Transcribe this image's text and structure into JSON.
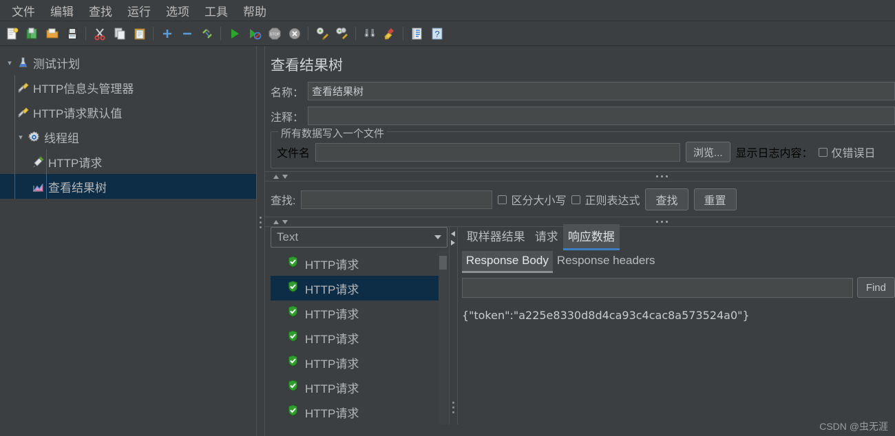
{
  "menubar": {
    "items": [
      {
        "label": "文件",
        "name": "menu-file"
      },
      {
        "label": "编辑",
        "name": "menu-edit"
      },
      {
        "label": "查找",
        "name": "menu-search"
      },
      {
        "label": "运行",
        "name": "menu-run"
      },
      {
        "label": "选项",
        "name": "menu-options"
      },
      {
        "label": "工具",
        "name": "menu-tools"
      },
      {
        "label": "帮助",
        "name": "menu-help"
      }
    ]
  },
  "toolbar": {
    "buttons": [
      {
        "icon": "new-document-icon"
      },
      {
        "icon": "open-template-icon"
      },
      {
        "icon": "open-folder-icon"
      },
      {
        "icon": "save-icon"
      },
      {
        "sep": true
      },
      {
        "icon": "cut-scissors-icon"
      },
      {
        "icon": "copy-icon"
      },
      {
        "icon": "paste-clipboard-icon"
      },
      {
        "sep": true
      },
      {
        "icon": "add-plus-icon"
      },
      {
        "icon": "remove-minus-icon"
      },
      {
        "icon": "toggle-icon"
      },
      {
        "sep": true
      },
      {
        "icon": "start-play-icon"
      },
      {
        "icon": "start-no-pauses-icon"
      },
      {
        "icon": "stop-icon"
      },
      {
        "icon": "shutdown-icon"
      },
      {
        "sep": true
      },
      {
        "icon": "clear-icon"
      },
      {
        "icon": "clear-all-icon"
      },
      {
        "sep": true
      },
      {
        "icon": "search-binoculars-icon"
      },
      {
        "icon": "search-reset-broom-icon"
      },
      {
        "sep": true
      },
      {
        "icon": "function-helper-icon"
      },
      {
        "icon": "help-question-icon"
      }
    ]
  },
  "tree": {
    "nodes": [
      {
        "label": "测试计划",
        "icon": "test-plan-icon",
        "level": 0,
        "expanded": true,
        "selected": false
      },
      {
        "label": "HTTP信息头管理器",
        "icon": "header-manager-icon",
        "level": 1,
        "expanded": null,
        "selected": false
      },
      {
        "label": "HTTP请求默认值",
        "icon": "http-defaults-icon",
        "level": 1,
        "expanded": null,
        "selected": false
      },
      {
        "label": "线程组",
        "icon": "thread-group-icon",
        "level": 1,
        "expanded": true,
        "selected": false
      },
      {
        "label": "HTTP请求",
        "icon": "http-request-icon",
        "level": 2,
        "expanded": null,
        "selected": false
      },
      {
        "label": "查看结果树",
        "icon": "view-results-tree-icon",
        "level": 2,
        "expanded": null,
        "selected": true
      }
    ]
  },
  "panel": {
    "title": "查看结果树",
    "name_label": "名称：",
    "name_value": "查看结果树",
    "comment_label": "注释：",
    "comment_value": "",
    "filegroup": {
      "title": "所有数据写入一个文件",
      "filename_label": "文件名",
      "filename_value": "",
      "browse_button": "浏览...",
      "log_display_label": "显示日志内容：",
      "errors_only_label": "仅错误日",
      "errors_only_checked": false
    },
    "search": {
      "label": "查找:",
      "value": "",
      "case_sensitive_label": "区分大小写",
      "case_sensitive_checked": false,
      "regex_label": "正则表达式",
      "regex_checked": false,
      "find_button": "查找",
      "reset_button": "重置"
    },
    "renderer": {
      "selected": "Text"
    },
    "results": [
      {
        "label": "HTTP请求",
        "status": "success",
        "selected": false
      },
      {
        "label": "HTTP请求",
        "status": "success",
        "selected": true
      },
      {
        "label": "HTTP请求",
        "status": "success",
        "selected": false
      },
      {
        "label": "HTTP请求",
        "status": "success",
        "selected": false
      },
      {
        "label": "HTTP请求",
        "status": "success",
        "selected": false
      },
      {
        "label": "HTTP请求",
        "status": "success",
        "selected": false
      },
      {
        "label": "HTTP请求",
        "status": "success",
        "selected": false
      }
    ],
    "tabs": [
      {
        "label": "取样器结果",
        "active": false
      },
      {
        "label": "请求",
        "active": false
      },
      {
        "label": "响应数据",
        "active": true
      }
    ],
    "subtabs": [
      {
        "label": "Response Body",
        "active": true
      },
      {
        "label": "Response headers",
        "active": false
      }
    ],
    "find_field_value": "",
    "find_button": "Find",
    "response_body": "{\"token\":\"a225e8330d8d4ca93c4cac8a573524a0\"}"
  },
  "watermark": "CSDN @虫无涯",
  "colors": {
    "background": "#3c3f41",
    "selection": "#0d2c45",
    "accent": "#3d7fc1",
    "text": "#b4b7ba",
    "success": "#3aa33a"
  }
}
